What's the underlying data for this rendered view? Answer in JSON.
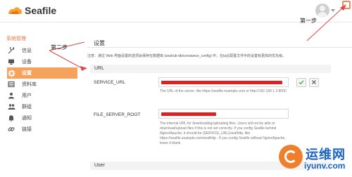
{
  "app": {
    "name": "Seafile"
  },
  "annotations": {
    "step1": "第一步",
    "step2": "第二步"
  },
  "sidebar": {
    "title": "系统管理",
    "items": [
      {
        "label": "信息",
        "icon": "wrench-icon"
      },
      {
        "label": "设备",
        "icon": "monitor-icon"
      },
      {
        "label": "设置",
        "icon": "gear-icon",
        "active": true
      },
      {
        "label": "资料库",
        "icon": "library-icon"
      },
      {
        "label": "用户",
        "icon": "user-icon"
      },
      {
        "label": "群组",
        "icon": "group-icon"
      },
      {
        "label": "通知",
        "icon": "bell-icon"
      },
      {
        "label": "链接",
        "icon": "link-icon"
      }
    ]
  },
  "main": {
    "title": "设置",
    "description": "注意：通过 Web 界面设置的选项会保存在数据库 (seahub-db/constance_config) 中，在ta比配置文件中的设置有更高的优先级。",
    "sections": [
      {
        "title": "URL",
        "fields": [
          {
            "label": "SERVICE_URL",
            "help": "The URL of the server, like https://seafile.example.com or http://192.168.1.2:8000"
          },
          {
            "label": "FILE_SERVER_ROOT",
            "help": "The internal URL for downloading/uploading files. Users will not be able to download/upload files if this is not set correctly. If you config Seafile behind Nginx/Apache, it should be {SERVICE_URL}/seafhttp, like https://seafile.example.com/seafhttp . If you config Seafile without Nginx/Apache, leave it blank."
          }
        ]
      },
      {
        "title": "User"
      }
    ],
    "actions": {
      "confirm_icon": "check-icon",
      "cancel_icon": "close-icon"
    }
  },
  "watermark": {
    "cn": "运维网",
    "url": "iyunv.com"
  },
  "colors": {
    "accent": "#f5a35c",
    "sidebar_title": "#e8744a",
    "redaction": "#e02121",
    "watermark_blue": "#1b63c6",
    "watermark_orange": "#f07f2c"
  }
}
